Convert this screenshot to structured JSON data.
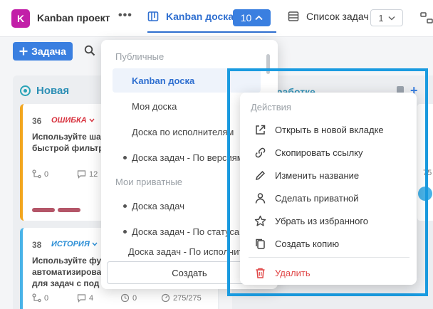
{
  "topbar": {
    "project_avatar_letter": "K",
    "project_name": "Kanban проект",
    "more": "•••",
    "active_tab": "Kanban доска",
    "active_tab_count": "10",
    "list_tab": "Список задач",
    "list_tab_count": "1"
  },
  "toolbar": {
    "add_task_label": "Задача"
  },
  "columns": {
    "new": {
      "title": "Новая"
    },
    "right": {
      "title": "работке",
      "pct_fragment": "75"
    }
  },
  "cards": [
    {
      "number": "36",
      "type": "ОШИБКА",
      "title_lines": [
        "Используйте ша",
        "быстрой фильтр"
      ],
      "subtasks": "0",
      "comments": "12"
    },
    {
      "number": "38",
      "type": "ИСТОРИЯ",
      "title_lines": [
        "Используйте фу",
        "автоматизирова",
        "для задач с под"
      ],
      "subtasks": "0",
      "comments": "4",
      "attachments": "0",
      "time": "275/275"
    }
  ],
  "board_menu": {
    "public_header": "Публичные",
    "public_items": [
      {
        "label": "Kanban доска",
        "selected": true,
        "dot": false
      },
      {
        "label": "Моя доска",
        "selected": false,
        "dot": false
      },
      {
        "label": "Доска по исполнителям",
        "selected": false,
        "dot": false
      },
      {
        "label": "Доска задач - По версиям",
        "selected": false,
        "dot": true
      }
    ],
    "private_header": "Мои приватные",
    "private_items": [
      {
        "label": "Доска задач",
        "dot": true
      },
      {
        "label": "Доска задач - По статусам",
        "dot": true
      },
      {
        "label": "Доска задач - По исполнителям",
        "dot": true
      }
    ],
    "create_label": "Создать"
  },
  "actions_menu": {
    "title": "Действия",
    "items": [
      {
        "label": "Открыть в новой вкладке",
        "icon": "external-link-icon"
      },
      {
        "label": "Скопировать ссылку",
        "icon": "link-icon"
      },
      {
        "label": "Изменить название",
        "icon": "pencil-icon"
      },
      {
        "label": "Сделать приватной",
        "icon": "person-icon"
      },
      {
        "label": "Убрать из избранного",
        "icon": "star-icon"
      },
      {
        "label": "Создать копию",
        "icon": "copy-icon"
      }
    ],
    "delete_label": "Удалить"
  },
  "colors": {
    "accent": "#3a7fe0",
    "highlight": "#1a9be0",
    "danger": "#e04747",
    "project": "#c21fa8"
  }
}
